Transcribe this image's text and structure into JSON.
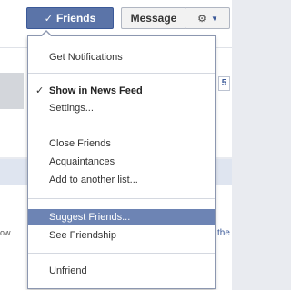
{
  "profile_actions": {
    "friends_label": "Friends",
    "message_label": "Message",
    "gear_icon": "gear-icon",
    "caret_icon": "chevron-down-icon"
  },
  "menu": {
    "items": [
      {
        "label": "Get Notifications",
        "checked": false,
        "bold": false,
        "highlighted": false
      },
      {
        "label": "Show in News Feed",
        "checked": true,
        "bold": true,
        "highlighted": false
      },
      {
        "label": "Settings...",
        "checked": false,
        "bold": false,
        "highlighted": false
      },
      {
        "label": "Close Friends",
        "checked": false,
        "bold": false,
        "highlighted": false
      },
      {
        "label": "Acquaintances",
        "checked": false,
        "bold": false,
        "highlighted": false
      },
      {
        "label": "Add to another list...",
        "checked": false,
        "bold": false,
        "highlighted": false
      },
      {
        "label": "Suggest Friends...",
        "checked": false,
        "bold": false,
        "highlighted": true
      },
      {
        "label": "See Friendship",
        "checked": false,
        "bold": false,
        "highlighted": false
      },
      {
        "label": "Unfriend",
        "checked": false,
        "bold": false,
        "highlighted": false
      }
    ]
  },
  "background": {
    "count_badge": "5",
    "right_fragment": "the",
    "left_fragment": "ow"
  },
  "colors": {
    "accent": "#3b5998",
    "highlight": "#6d84b4"
  }
}
